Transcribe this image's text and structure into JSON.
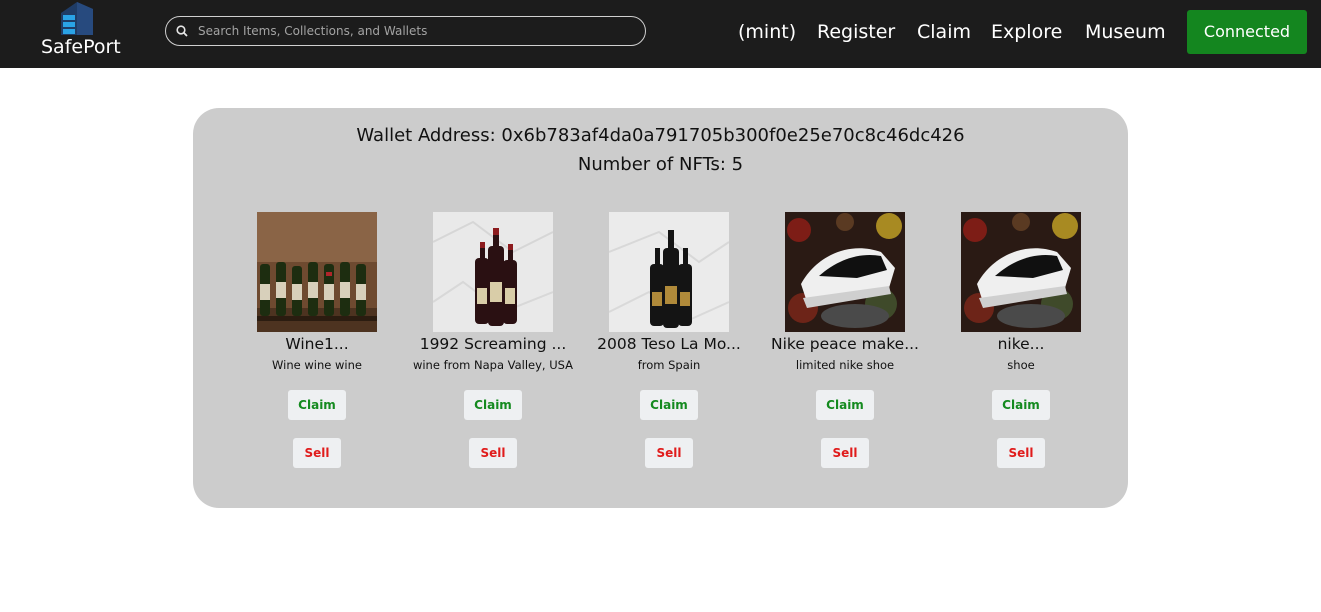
{
  "header": {
    "brand_name": "SafePort",
    "logo_icon": "building-icon",
    "search_placeholder": "Search Items, Collections, and Wallets",
    "nav": [
      {
        "label": "(mint)"
      },
      {
        "label": "Register"
      },
      {
        "label": "Claim"
      },
      {
        "label": "Explore"
      },
      {
        "label": "Museum"
      }
    ],
    "connect_label": "Connected",
    "connect_color": "#14861f"
  },
  "wallet": {
    "address_label": "Wallet Address: 0x6b783af4da0a791705b300f0e25e70c8c46dc426",
    "count_label": "Number of NFTs:  5"
  },
  "nfts": [
    {
      "title": "Wine1...",
      "description": "Wine wine wine",
      "claim_label": "Claim",
      "sell_label": "Sell"
    },
    {
      "title": "1992 Screaming ...",
      "description": "wine from Napa Valley, USA",
      "claim_label": "Claim",
      "sell_label": "Sell"
    },
    {
      "title": "2008 Teso La Mo...",
      "description": "from Spain",
      "claim_label": "Claim",
      "sell_label": "Sell"
    },
    {
      "title": "Nike peace make...",
      "description": "limited nike shoe",
      "claim_label": "Claim",
      "sell_label": "Sell"
    },
    {
      "title": "nike...",
      "description": "shoe",
      "claim_label": "Claim",
      "sell_label": "Sell"
    }
  ],
  "colors": {
    "navbar": "#1c1c1c",
    "card": "#cccccc",
    "claim_text": "#148a1f",
    "sell_text": "#e01b1b"
  }
}
